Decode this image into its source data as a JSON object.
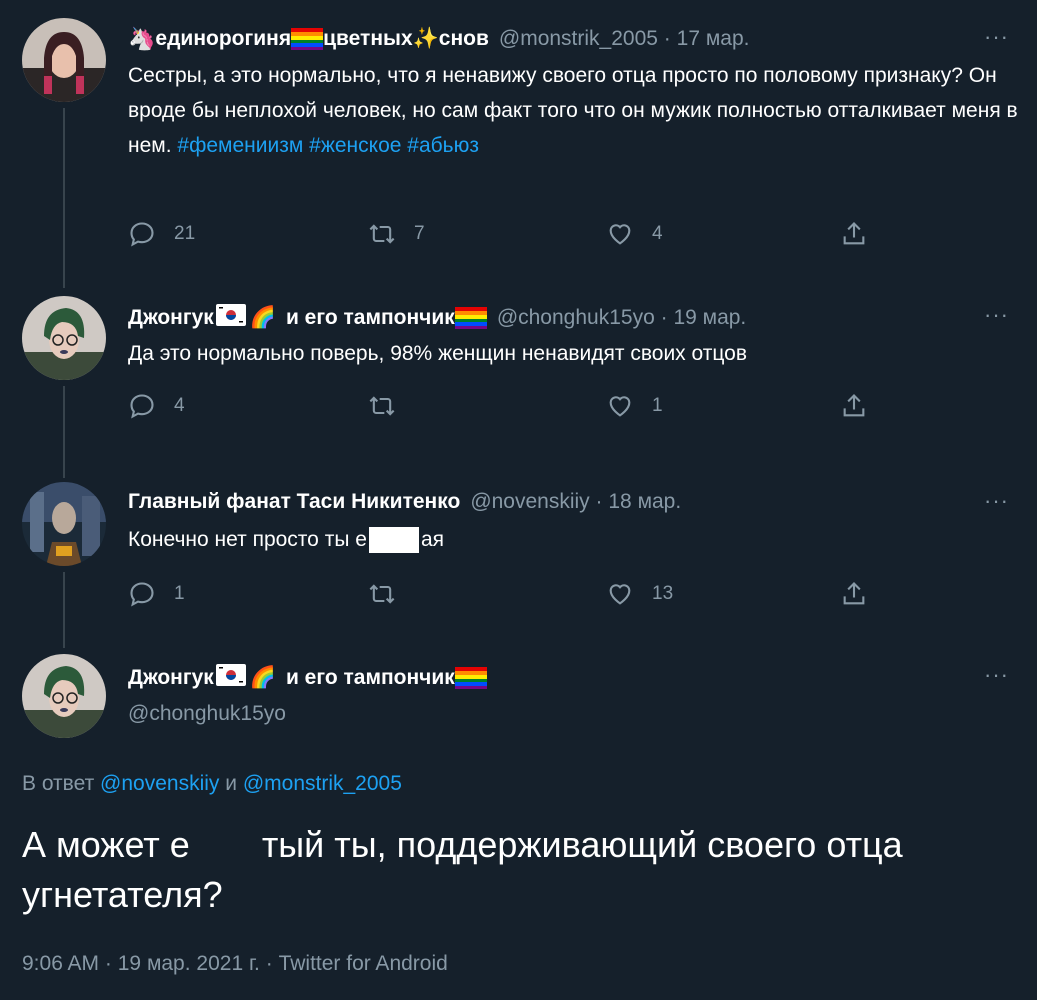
{
  "tweet1": {
    "name_prefix": "единорогиня",
    "name_mid": "цветных",
    "name_suffix": "снов",
    "handle": "@monstrik_2005",
    "date": "17 мар.",
    "text": "Сестры, а это нормально, что я ненавижу своего отца просто по половому признаку? Он вроде бы неплохой человек, но сам факт того что он мужик полностью отталкивает меня в нем.",
    "hashtags": [
      "#фемениизм",
      "#женское",
      "#абьюз"
    ],
    "replies": "21",
    "retweets": "7",
    "likes": "4"
  },
  "tweet2": {
    "name_a": "Джонгук",
    "name_b": "и его тампончик",
    "handle": "@chonghuk15yo",
    "date": "19 мар.",
    "text": "Да это нормально поверь, 98% женщин ненавидят своих отцов",
    "replies": "4",
    "retweets": "",
    "likes": "1"
  },
  "tweet3": {
    "name": "Главный фанат Таси Никитенко",
    "handle": "@novenskiiy",
    "date": "18 мар.",
    "text_a": "Конечно нет просто ты е",
    "text_b": "ая",
    "replies": "1",
    "retweets": "",
    "likes": "13"
  },
  "main": {
    "name_a": "Джонгук",
    "name_b": "и его тампончик",
    "handle": "@chonghuk15yo",
    "reply_prefix": "В ответ",
    "reply_mention1": "@novenskiiy",
    "reply_and": "и",
    "reply_mention2": "@monstrik_2005",
    "text_a": "А может е",
    "text_b": "тый ты, поддерживающий своего отца угнетателя?",
    "time": "9:06 AM",
    "date": "19 мар. 2021 г.",
    "source": "Twitter for Android"
  },
  "more_label": "···",
  "separator": "·",
  "colors": {
    "background": "#15202b",
    "accent": "#1da1f2",
    "muted": "#8899a6"
  }
}
